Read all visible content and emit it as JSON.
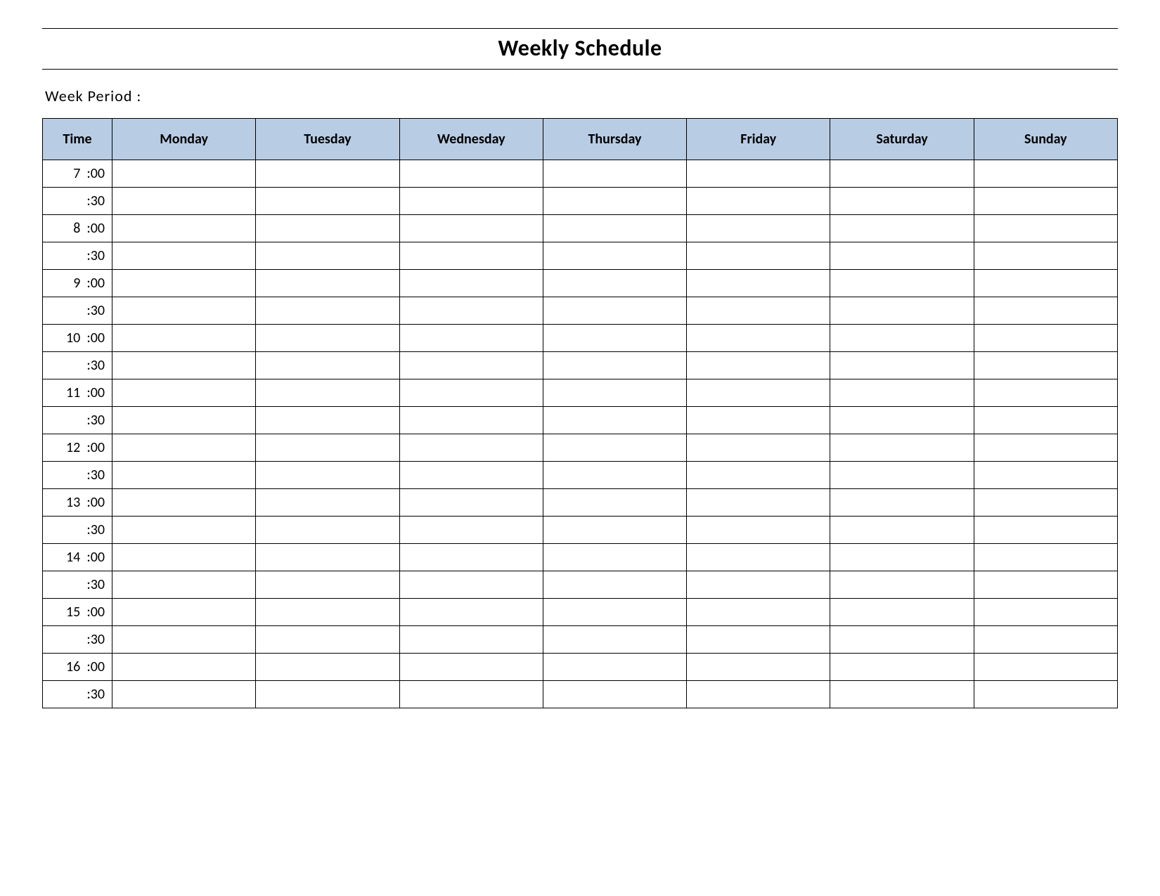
{
  "title": "Weekly Schedule",
  "week_period_label": "Week  Period :",
  "headers": {
    "time": "Time",
    "days": [
      "Monday",
      "Tuesday",
      "Wednesday",
      "Thursday",
      "Friday",
      "Saturday",
      "Sunday"
    ]
  },
  "time_rows": [
    {
      "label": "7  :00",
      "half": false
    },
    {
      "label": ":30",
      "half": true
    },
    {
      "label": "8  :00",
      "half": false
    },
    {
      "label": ":30",
      "half": true
    },
    {
      "label": "9  :00",
      "half": false
    },
    {
      "label": ":30",
      "half": true
    },
    {
      "label": "10  :00",
      "half": false
    },
    {
      "label": ":30",
      "half": true
    },
    {
      "label": "11  :00",
      "half": false
    },
    {
      "label": ":30",
      "half": true
    },
    {
      "label": "12  :00",
      "half": false
    },
    {
      "label": ":30",
      "half": true
    },
    {
      "label": "13  :00",
      "half": false
    },
    {
      "label": ":30",
      "half": true
    },
    {
      "label": "14  :00",
      "half": false
    },
    {
      "label": ":30",
      "half": true
    },
    {
      "label": "15  :00",
      "half": false
    },
    {
      "label": ":30",
      "half": true
    },
    {
      "label": "16  :00",
      "half": false
    },
    {
      "label": ":30",
      "half": true
    }
  ]
}
